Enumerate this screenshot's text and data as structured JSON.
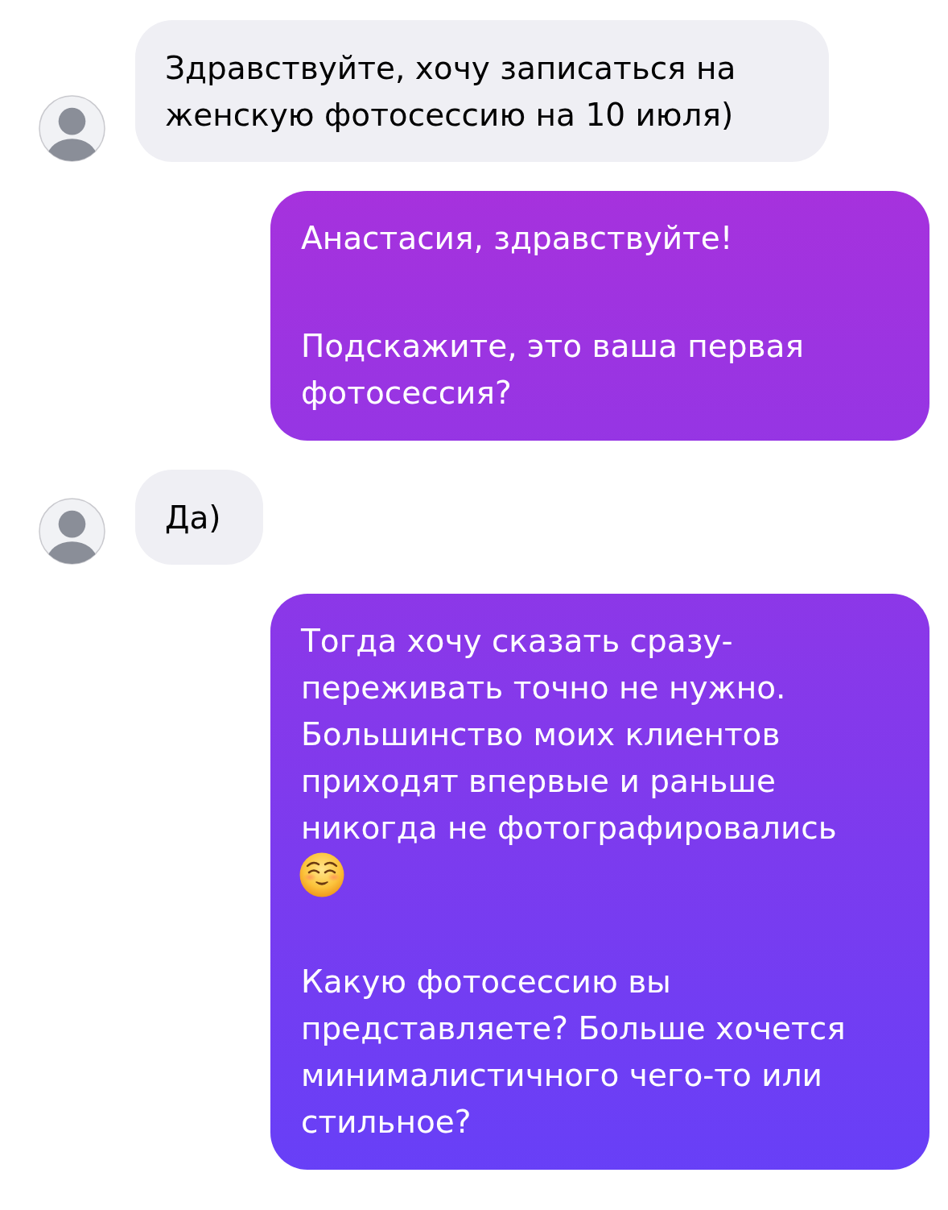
{
  "messages": [
    {
      "kind": "incoming",
      "parts": [
        {
          "kind": "text",
          "text": "Здравствуйте, хочу записаться на женскую фотосессию на 10 июля)"
        }
      ]
    },
    {
      "kind": "outgoing",
      "parts": [
        {
          "kind": "text",
          "text": "Анастасия, здравствуйте!"
        },
        {
          "kind": "text",
          "text": "Подскажите, это ваша первая фотосессия?"
        }
      ]
    },
    {
      "kind": "incoming",
      "parts": [
        {
          "kind": "text",
          "text": "Да)"
        }
      ]
    },
    {
      "kind": "outgoing",
      "parts": [
        {
          "kind": "text",
          "text": "Тогда хочу сказать сразу- переживать точно не нужно. Большинство моих клиентов приходят впервые и раньше никогда не фотографировались"
        },
        {
          "kind": "emoji"
        },
        {
          "kind": "text",
          "text": "Какую фотосессию вы представляете? Больше хочется минималистичного чего-то или стильное?"
        }
      ]
    }
  ]
}
